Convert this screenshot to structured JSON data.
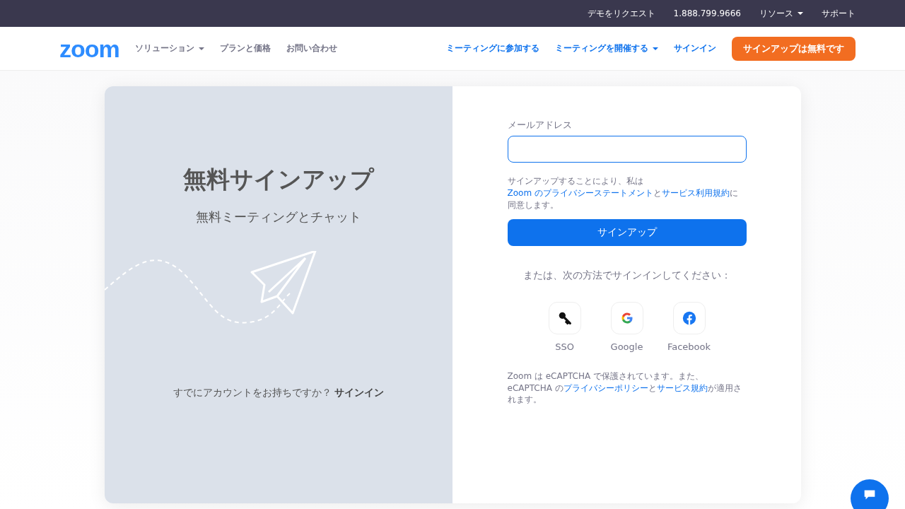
{
  "top_bar": {
    "links": [
      "デモをリクエスト",
      "1.888.799.9666",
      "リソース",
      "サポート"
    ],
    "dropdown": [
      false,
      false,
      true,
      false
    ]
  },
  "header": {
    "logo": "zoom",
    "nav_left": [
      {
        "label": "ソリューション",
        "has_dropdown": true
      },
      {
        "label": "プランと価格",
        "has_dropdown": false
      },
      {
        "label": "お問い合わせ",
        "has_dropdown": false
      }
    ],
    "nav_right": [
      {
        "label": "ミーティングに参加する",
        "has_dropdown": false
      },
      {
        "label": "ミーティングを開催する",
        "has_dropdown": true
      },
      {
        "label": "サインイン",
        "has_dropdown": false
      }
    ],
    "cta": "サインアップは無料です"
  },
  "promo": {
    "title": "無料サインアップ",
    "subtitle": "無料ミーティングとチャット",
    "account_prompt": "すでにアカウントをお持ちですか？",
    "signin_link": "サインイン"
  },
  "form": {
    "email_label": "メールアドレス",
    "consent": [
      {
        "kind": "text",
        "text": "サインアップすることにより、私は"
      },
      {
        "kind": "link",
        "text": "Zoom のプライバシーステートメント"
      },
      {
        "kind": "text",
        "text": "と"
      },
      {
        "kind": "link",
        "text": "サービス利用規約"
      },
      {
        "kind": "text",
        "text": "に同意します。"
      }
    ],
    "submit": "サインアップ",
    "alt_prompt": "または、次の方法でサインインしてください：",
    "providers": [
      {
        "kind": "sso",
        "label": "SSO"
      },
      {
        "kind": "google",
        "label": "Google"
      },
      {
        "kind": "facebook",
        "label": "Facebook"
      }
    ],
    "captcha": [
      {
        "kind": "text",
        "text": "Zoom は eCAPTCHA で保護されています。また、eCAPTCHA の"
      },
      {
        "kind": "link",
        "text": "プライバシーポリシー"
      },
      {
        "kind": "text",
        "text": "と"
      },
      {
        "kind": "link",
        "text": "サービス規約"
      },
      {
        "kind": "text",
        "text": "が適用されます。"
      }
    ]
  }
}
